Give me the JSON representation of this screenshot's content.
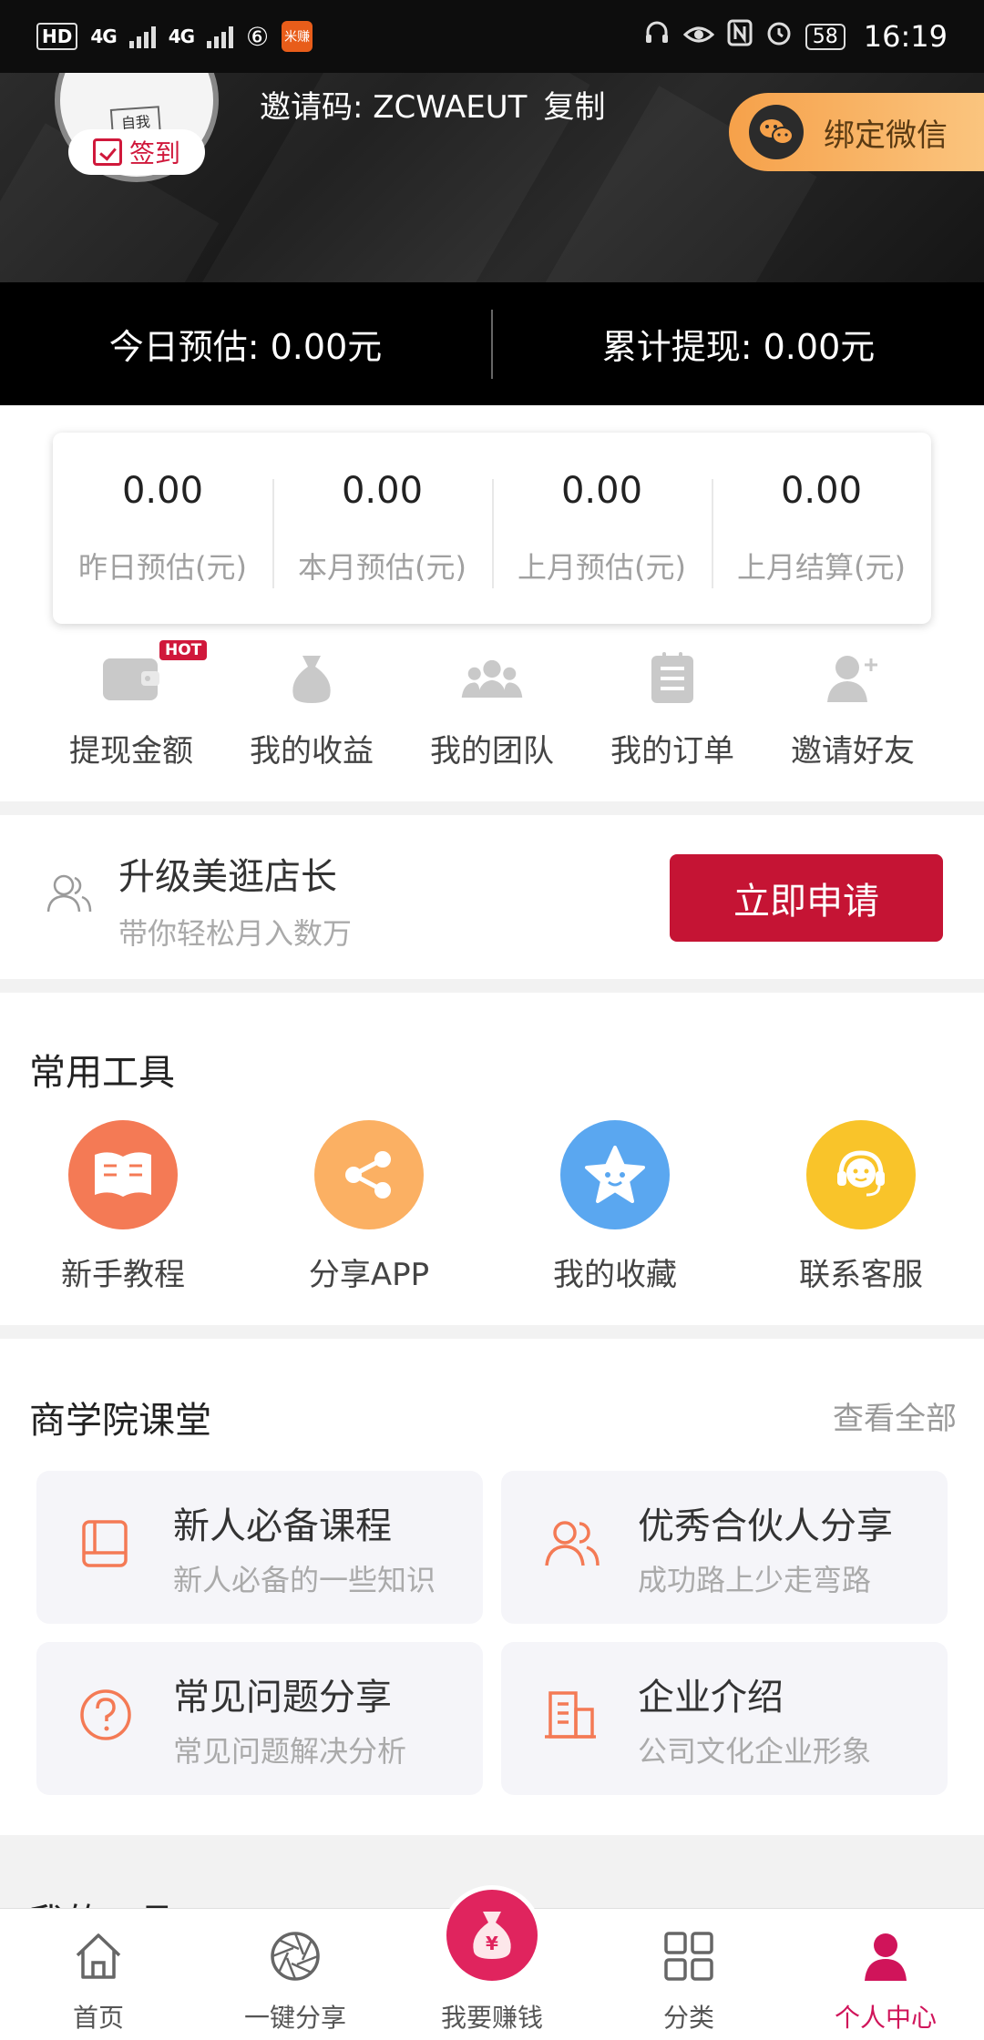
{
  "status_bar": {
    "left_badges": [
      "HD",
      "4G",
      "4G"
    ],
    "app_badge": "米赚",
    "battery": "58",
    "time": "16:19"
  },
  "header": {
    "avatar_stamp_text": "自我\n控制",
    "signin_label": "签到",
    "invite_label": "邀请码: ZCWAEUT",
    "copy_label": "复制",
    "bind_wechat_label": "绑定微信"
  },
  "earnings": {
    "today_estimate": "今日预估: 0.00元",
    "total_withdraw": "累计提现: 0.00元"
  },
  "stats": [
    {
      "value": "0.00",
      "label": "昨日预估(元)"
    },
    {
      "value": "0.00",
      "label": "本月预估(元)"
    },
    {
      "value": "0.00",
      "label": "上月预估(元)"
    },
    {
      "value": "0.00",
      "label": "上月结算(元)"
    }
  ],
  "quick_nav": {
    "hot_badge": "HOT",
    "items": [
      {
        "label": "提现金额",
        "icon": "wallet-icon"
      },
      {
        "label": "我的收益",
        "icon": "money-bag-icon"
      },
      {
        "label": "我的团队",
        "icon": "team-icon"
      },
      {
        "label": "我的订单",
        "icon": "order-icon"
      },
      {
        "label": "邀请好友",
        "icon": "add-friend-icon"
      }
    ]
  },
  "upgrade": {
    "title": "升级美逛店长",
    "subtitle": "带你轻松月入数万",
    "button": "立即申请"
  },
  "tools": {
    "title": "常用工具",
    "items": [
      {
        "label": "新手教程",
        "icon": "book-icon",
        "color": "#f47a55"
      },
      {
        "label": "分享APP",
        "icon": "share-icon",
        "color": "#fbb063"
      },
      {
        "label": "我的收藏",
        "icon": "star-icon",
        "color": "#5aa7f0"
      },
      {
        "label": "联系客服",
        "icon": "headset-icon",
        "color": "#f9c42a"
      }
    ]
  },
  "academy": {
    "title": "商学院课堂",
    "see_all": "查看全部",
    "courses": [
      {
        "title": "新人必备课程",
        "subtitle": "新人必备的一些知识",
        "icon": "book-outline-icon"
      },
      {
        "title": "优秀合伙人分享",
        "subtitle": "成功路上少走弯路",
        "icon": "partners-icon"
      },
      {
        "title": "常见问题分享",
        "subtitle": "常见问题解决分析",
        "icon": "question-icon"
      },
      {
        "title": "企业介绍",
        "subtitle": "公司文化企业形象",
        "icon": "building-icon"
      }
    ],
    "accent": "#f47a55"
  },
  "peek_section_title": "我的工具",
  "bottom_nav": [
    {
      "label": "首页",
      "icon": "home-icon"
    },
    {
      "label": "一键分享",
      "icon": "aperture-icon"
    },
    {
      "label": "我要赚钱",
      "icon": "money-bag-icon"
    },
    {
      "label": "分类",
      "icon": "grid-icon"
    },
    {
      "label": "个人中心",
      "icon": "person-icon",
      "active": true
    }
  ],
  "colors": {
    "brand_red": "#c51434",
    "active_pink": "#d0145a",
    "wechat_gold": "#f6a14a"
  }
}
